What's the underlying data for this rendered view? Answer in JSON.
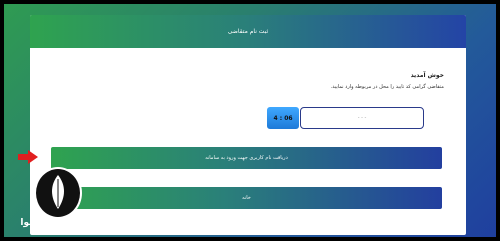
{
  "header": {
    "title": "ثبت نام متقاضی"
  },
  "welcome": {
    "title": "خوش آمدید",
    "description": "متقاضی گرامی کد تایید را محل در مربوطه وارد نمایید."
  },
  "form": {
    "code_placeholder": "- - -",
    "timer": "4 : 06"
  },
  "buttons": {
    "receive_label": "دریافت نام کاربری جهت ورود به سامانه",
    "no_label": "خانه"
  },
  "watermark": {
    "text": "سامانه مشاوره هیوا"
  },
  "icons": {
    "arrow": "arrow-right-icon",
    "logo": "feather-pen-icon"
  },
  "colors": {
    "accent_green": "#2fa34f",
    "accent_blue": "#233f9f",
    "timer_blue": "#3fa8ff",
    "arrow_red": "#e11f1f"
  }
}
